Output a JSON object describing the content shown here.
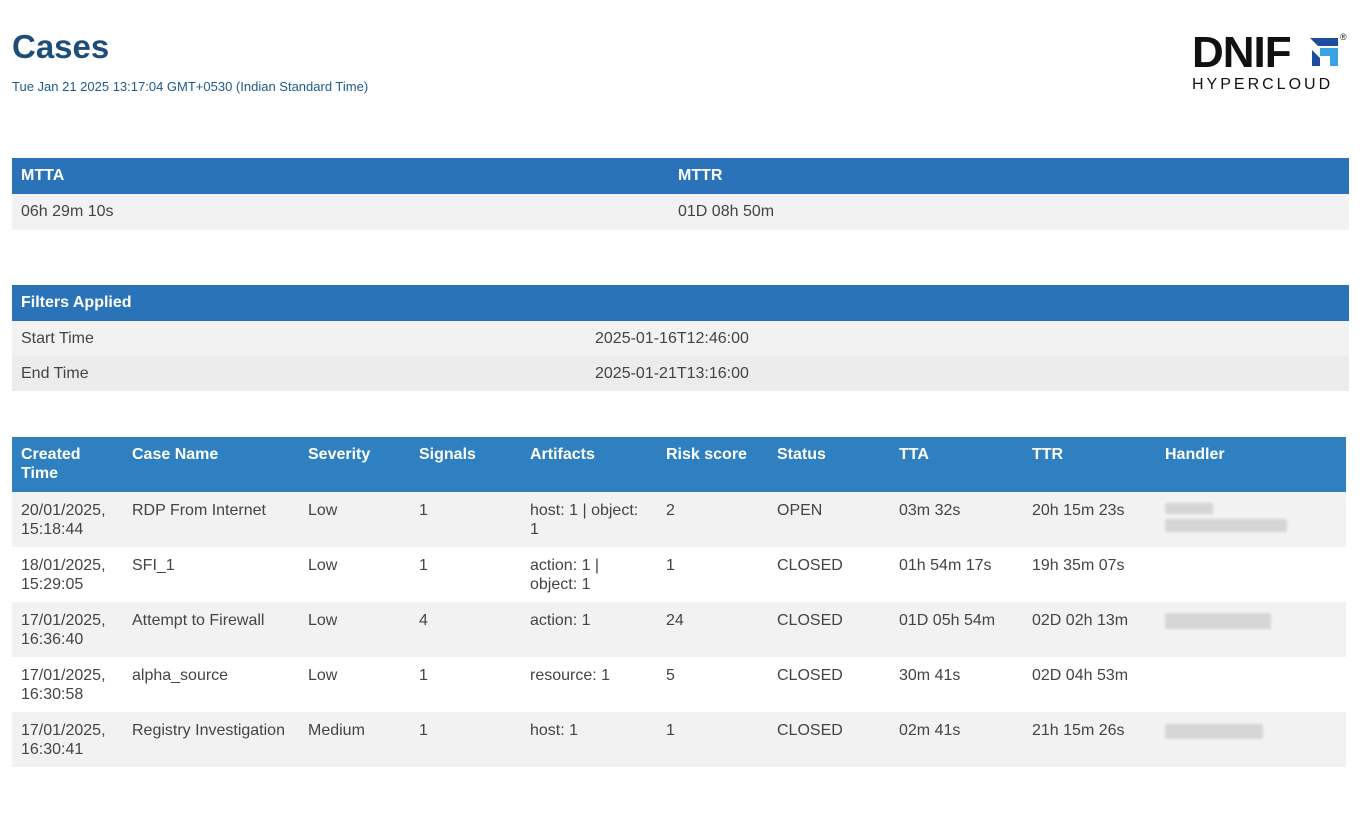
{
  "header": {
    "title": "Cases",
    "timestamp": "Tue Jan 21 2025 13:17:04 GMT+0530 (Indian Standard Time)"
  },
  "logo": {
    "word": "DNIF",
    "subword": "HYPERCLOUD",
    "registered": "®",
    "colors": {
      "text": "#111111",
      "mark_dark": "#1d4e9e",
      "mark_light": "#3aa3e3"
    }
  },
  "metrics": {
    "mtta_label": "MTTA",
    "mttr_label": "MTTR",
    "mtta_value": "06h 29m 10s",
    "mttr_value": "01D 08h 50m"
  },
  "filters": {
    "heading": "Filters Applied",
    "rows": [
      {
        "label": "Start Time",
        "value": "2025-01-16T12:46:00"
      },
      {
        "label": "End Time",
        "value": "2025-01-21T13:16:00"
      }
    ]
  },
  "cases": {
    "columns": [
      "Created Time",
      "Case Name",
      "Severity",
      "Signals",
      "Artifacts",
      "Risk score",
      "Status",
      "TTA",
      "TTR",
      "Handler"
    ],
    "rows": [
      {
        "created": "20/01/2025, 15:18:44",
        "name": "RDP From Internet",
        "severity": "Low",
        "signals": "1",
        "artifacts": "host: 1 | object: 1",
        "risk": "2",
        "status": "OPEN",
        "tta": "03m 32s",
        "ttr": "20h 15m 23s",
        "handler": "redacted"
      },
      {
        "created": "18/01/2025, 15:29:05",
        "name": "SFI_1",
        "severity": "Low",
        "signals": "1",
        "artifacts": "action: 1 | object: 1",
        "risk": "1",
        "status": "CLOSED",
        "tta": "01h 54m 17s",
        "ttr": "19h 35m 07s",
        "handler": ""
      },
      {
        "created": "17/01/2025, 16:36:40",
        "name": "Attempt to Firewall",
        "severity": "Low",
        "signals": "4",
        "artifacts": "action: 1",
        "risk": "24",
        "status": "CLOSED",
        "tta": "01D 05h 54m",
        "ttr": "02D 02h 13m",
        "handler": "redacted"
      },
      {
        "created": "17/01/2025, 16:30:58",
        "name": "alpha_source",
        "severity": "Low",
        "signals": "1",
        "artifacts": "resource: 1",
        "risk": "5",
        "status": "CLOSED",
        "tta": "30m 41s",
        "ttr": "02D 04h 53m",
        "handler": ""
      },
      {
        "created": "17/01/2025, 16:30:41",
        "name": "Registry Investigation",
        "severity": "Medium",
        "signals": "1",
        "artifacts": "host: 1",
        "risk": "1",
        "status": "CLOSED",
        "tta": "02m 41s",
        "ttr": "21h 15m 26s",
        "handler": "redacted"
      }
    ]
  },
  "colors": {
    "title": "#1d4e79",
    "header_bar": "#2b73b9",
    "table_header": "#2f80c0",
    "row_alt": "#f2f2f2"
  }
}
